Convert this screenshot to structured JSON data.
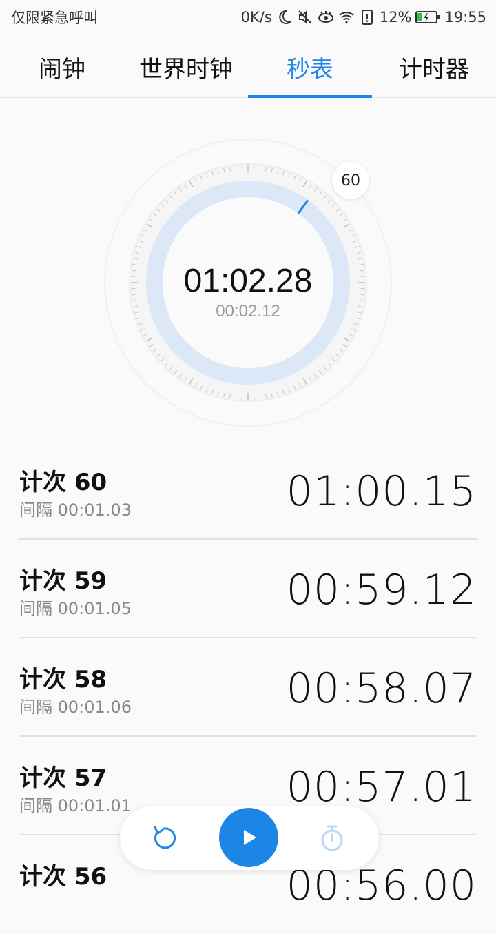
{
  "status_bar": {
    "carrier": "仅限紧急呼叫",
    "net_speed": "0K/s",
    "battery_percent": "12%",
    "time": "19:55"
  },
  "tabs": [
    {
      "label": "闹钟",
      "active": false
    },
    {
      "label": "世界时钟",
      "active": false
    },
    {
      "label": "秒表",
      "active": true
    },
    {
      "label": "计时器",
      "active": false
    }
  ],
  "stopwatch": {
    "main_time": "01:02.28",
    "lap_time": "00:02.12",
    "lap_badge": "60",
    "progress_fraction": 0.1
  },
  "laps": [
    {
      "title": "计次 60",
      "interval": "间隔 00:01.03",
      "total": "01:00.15"
    },
    {
      "title": "计次 59",
      "interval": "间隔 00:01.05",
      "total": "00:59.12"
    },
    {
      "title": "计次 58",
      "interval": "间隔 00:01.06",
      "total": "00:58.07"
    },
    {
      "title": "计次 57",
      "interval": "间隔 00:01.01",
      "total": "00:57.01"
    },
    {
      "title": "计次 56",
      "interval": "",
      "total": "00:56.00"
    }
  ],
  "colors": {
    "accent": "#1b86e6",
    "ring": "#dce8f8"
  },
  "icons": {
    "reset": "reset-icon",
    "play": "play-icon",
    "lap": "stopwatch-icon"
  }
}
